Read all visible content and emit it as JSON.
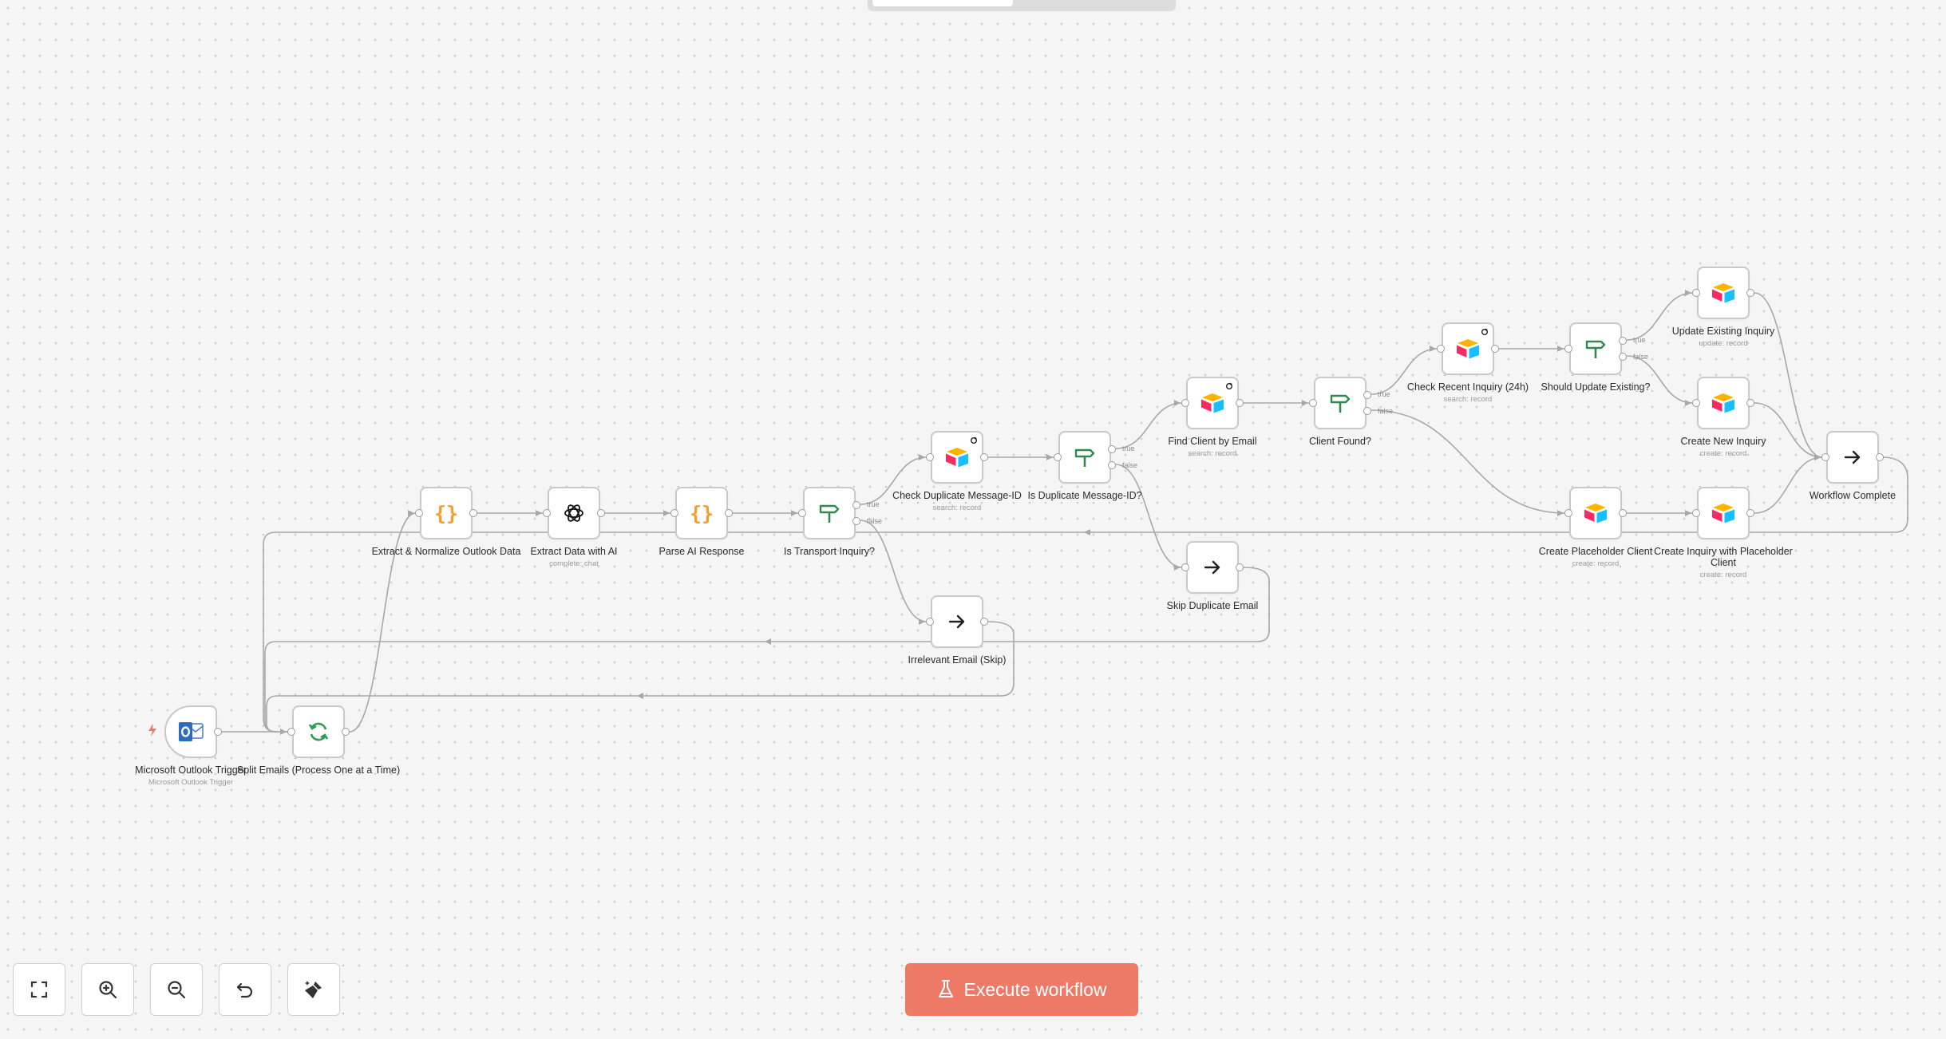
{
  "canvas": {
    "accent": "#ec7a66",
    "edge_color": "#a8a8a8",
    "grid_color": "#cfcfcf"
  },
  "nodes": [
    {
      "id": "outlook",
      "label": "Microsoft Outlook Trigger",
      "sub": "Microsoft Outlook Trigger",
      "icon": "outlook-icon"
    },
    {
      "id": "split",
      "label": "Split Emails (Process One at a Time)",
      "sub": "",
      "icon": "loop-icon"
    },
    {
      "id": "extract_normalize",
      "label": "Extract & Normalize Outlook Data",
      "sub": "",
      "icon": "code-braces-icon"
    },
    {
      "id": "extract_ai",
      "label": "Extract Data with AI",
      "sub": "complete: chat",
      "icon": "openai-icon"
    },
    {
      "id": "parse_ai",
      "label": "Parse AI Response",
      "sub": "",
      "icon": "code-braces-icon"
    },
    {
      "id": "is_transport",
      "label": "Is Transport Inquiry?",
      "sub": "",
      "icon": "if-signpost-icon"
    },
    {
      "id": "check_dup",
      "label": "Check Duplicate Message-ID",
      "sub": "search: record",
      "icon": "airtable-icon"
    },
    {
      "id": "irrelevant",
      "label": "Irrelevant Email (Skip)",
      "sub": "",
      "icon": "arrow-right-icon"
    },
    {
      "id": "is_dup",
      "label": "Is Duplicate Message-ID?",
      "sub": "",
      "icon": "if-signpost-icon"
    },
    {
      "id": "skip_dup",
      "label": "Skip Duplicate Email",
      "sub": "",
      "icon": "arrow-right-icon"
    },
    {
      "id": "find_client",
      "label": "Find Client by Email",
      "sub": "search: record",
      "icon": "airtable-icon"
    },
    {
      "id": "client_found",
      "label": "Client Found?",
      "sub": "",
      "icon": "if-signpost-icon"
    },
    {
      "id": "check_recent",
      "label": "Check Recent Inquiry (24h)",
      "sub": "search: record",
      "icon": "airtable-icon"
    },
    {
      "id": "should_update",
      "label": "Should Update Existing?",
      "sub": "",
      "icon": "if-signpost-icon"
    },
    {
      "id": "update_existing",
      "label": "Update Existing Inquiry",
      "sub": "update: record",
      "icon": "airtable-icon"
    },
    {
      "id": "create_new",
      "label": "Create New Inquiry",
      "sub": "create: record",
      "icon": "airtable-icon"
    },
    {
      "id": "create_placeholder",
      "label": "Create Placeholder Client",
      "sub": "create: record",
      "icon": "airtable-icon"
    },
    {
      "id": "create_with_placeholder",
      "label": "Create Inquiry with Placeholder Client",
      "sub": "create: record",
      "icon": "airtable-icon"
    },
    {
      "id": "workflow_complete",
      "label": "Workflow Complete",
      "sub": "",
      "icon": "arrow-right-icon"
    }
  ],
  "branch_labels": {
    "true": "true",
    "false": "false"
  },
  "controls": [
    {
      "id": "fit",
      "icon": "fit-view-icon"
    },
    {
      "id": "zoom_in",
      "icon": "zoom-in-icon"
    },
    {
      "id": "zoom_out",
      "icon": "zoom-out-icon"
    },
    {
      "id": "reset",
      "icon": "undo-icon"
    },
    {
      "id": "tidy",
      "icon": "tidy-up-icon"
    }
  ],
  "execute": {
    "label": "Execute workflow",
    "icon": "flask-icon"
  }
}
